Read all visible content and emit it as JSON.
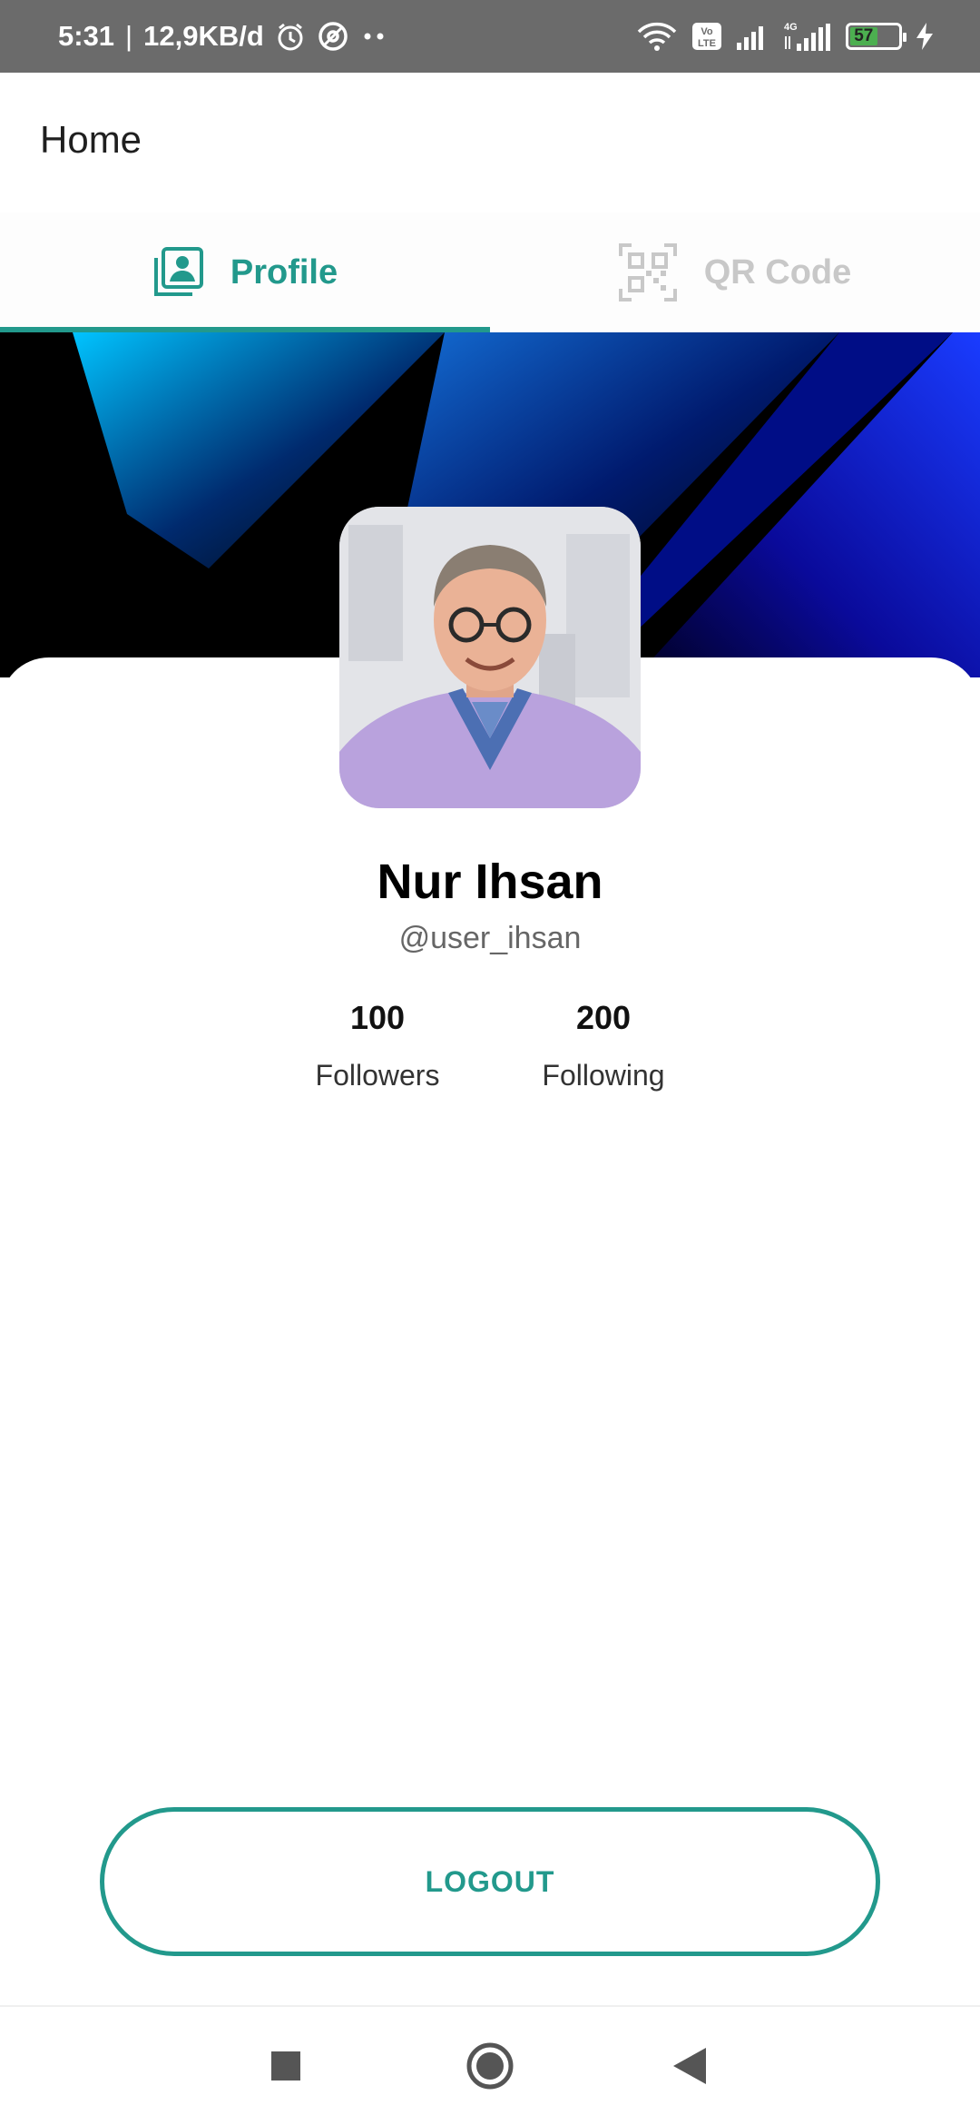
{
  "status_bar": {
    "time": "5:31",
    "separator": "|",
    "network_speed": "12,9KB/d",
    "battery_level": "57",
    "icons": [
      "alarm-icon",
      "at-sign-icon",
      "more-dots-icon",
      "wifi-icon",
      "volte-icon",
      "signal-icon",
      "4g-signal-icon",
      "battery-icon",
      "charging-icon"
    ]
  },
  "app_bar": {
    "title": "Home"
  },
  "tabs": [
    {
      "label": "Profile",
      "icon": "profile-card-icon",
      "active": true
    },
    {
      "label": "QR Code",
      "icon": "qr-code-icon",
      "active": false
    }
  ],
  "profile": {
    "name": "Nur Ihsan",
    "username": "@user_ihsan",
    "avatar": "profile-photo"
  },
  "stats": {
    "followers": {
      "value": "100",
      "label": "Followers"
    },
    "following": {
      "value": "200",
      "label": "Following"
    }
  },
  "logout_label": "LOGOUT",
  "nav_bar": {
    "icons": [
      "recents-square-icon",
      "home-circle-icon",
      "back-triangle-icon"
    ]
  },
  "colors": {
    "accent": "#22998c",
    "status_bar": "#6b6b6b",
    "battery": "#4caf50"
  }
}
